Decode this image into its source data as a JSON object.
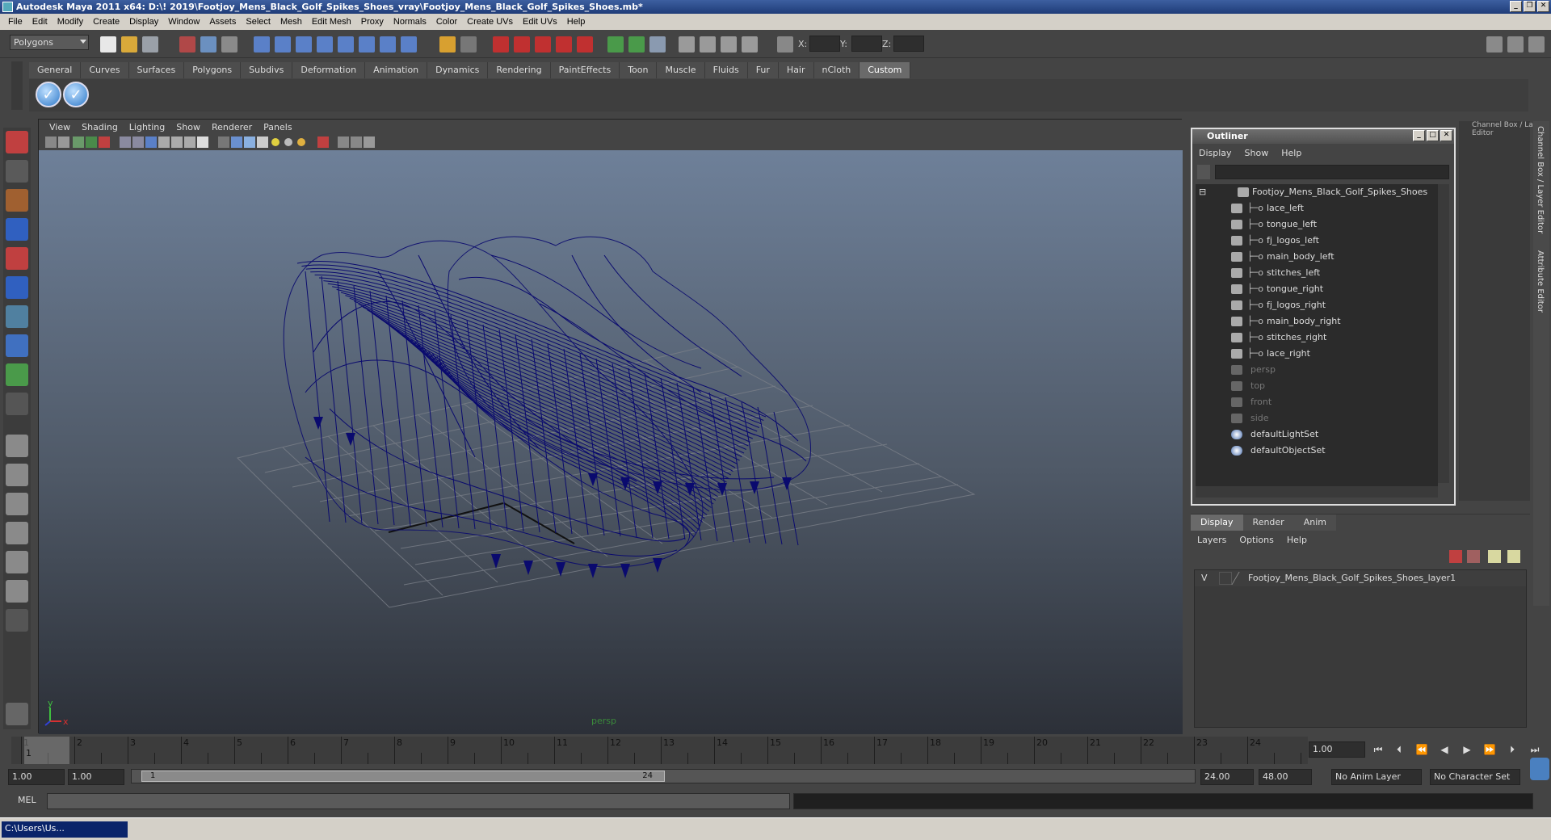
{
  "window": {
    "title": "Autodesk Maya 2011 x64: D:\\! 2019\\Footjoy_Mens_Black_Golf_Spikes_Shoes_vray\\Footjoy_Mens_Black_Golf_Spikes_Shoes.mb*"
  },
  "menubar": [
    "File",
    "Edit",
    "Modify",
    "Create",
    "Display",
    "Window",
    "Assets",
    "Select",
    "Mesh",
    "Edit Mesh",
    "Proxy",
    "Normals",
    "Color",
    "Create UVs",
    "Edit UVs",
    "Help"
  ],
  "status": {
    "menuset": "Polygons",
    "x_label": "X:",
    "y_label": "Y:",
    "z_label": "Z:"
  },
  "shelf": {
    "tabs": [
      "General",
      "Curves",
      "Surfaces",
      "Polygons",
      "Subdivs",
      "Deformation",
      "Animation",
      "Dynamics",
      "Rendering",
      "PaintEffects",
      "Toon",
      "Muscle",
      "Fluids",
      "Fur",
      "Hair",
      "nCloth",
      "Custom"
    ],
    "active_tab": "Custom"
  },
  "viewport": {
    "menu": [
      "View",
      "Shading",
      "Lighting",
      "Show",
      "Renderer",
      "Panels"
    ],
    "camera": "persp",
    "axis_y": "y",
    "axis_x": "x",
    "wire_color": "#0a0a6e"
  },
  "outliner": {
    "title": "Outliner",
    "menu": [
      "Display",
      "Show",
      "Help"
    ],
    "items": [
      {
        "label": "Footjoy_Mens_Black_Golf_Spikes_Shoes",
        "indent": 0,
        "dim": false
      },
      {
        "label": "lace_left",
        "indent": 1,
        "dim": false
      },
      {
        "label": "tongue_left",
        "indent": 1,
        "dim": false
      },
      {
        "label": "fj_logos_left",
        "indent": 1,
        "dim": false
      },
      {
        "label": "main_body_left",
        "indent": 1,
        "dim": false
      },
      {
        "label": "stitches_left",
        "indent": 1,
        "dim": false
      },
      {
        "label": "tongue_right",
        "indent": 1,
        "dim": false
      },
      {
        "label": "fj_logos_right",
        "indent": 1,
        "dim": false
      },
      {
        "label": "main_body_right",
        "indent": 1,
        "dim": false
      },
      {
        "label": "stitches_right",
        "indent": 1,
        "dim": false
      },
      {
        "label": "lace_right",
        "indent": 1,
        "dim": false
      },
      {
        "label": "persp",
        "indent": 0,
        "dim": true
      },
      {
        "label": "top",
        "indent": 0,
        "dim": true
      },
      {
        "label": "front",
        "indent": 0,
        "dim": true
      },
      {
        "label": "side",
        "indent": 0,
        "dim": true
      },
      {
        "label": "defaultLightSet",
        "indent": 0,
        "dim": false
      },
      {
        "label": "defaultObjectSet",
        "indent": 0,
        "dim": false
      }
    ]
  },
  "channelbox": {
    "label": "Channel Box / Layer Editor",
    "side_tabs": [
      "Channel Box / Layer Editor",
      "Attribute Editor"
    ]
  },
  "layers": {
    "tabs": [
      "Display",
      "Render",
      "Anim"
    ],
    "active_tab": "Display",
    "menu": [
      "Layers",
      "Options",
      "Help"
    ],
    "layer_visibility": "V",
    "layer_name": "Footjoy_Mens_Black_Golf_Spikes_Shoes_layer1"
  },
  "timeline": {
    "ticks": [
      "1",
      "2",
      "3",
      "4",
      "5",
      "6",
      "7",
      "8",
      "9",
      "10",
      "11",
      "12",
      "13",
      "14",
      "15",
      "16",
      "17",
      "18",
      "19",
      "20",
      "21",
      "22",
      "23",
      "24"
    ],
    "current_frame": "1.00",
    "current_marker": "1"
  },
  "range": {
    "start": "1.00",
    "anim_start": "1.00",
    "slider_start": "1",
    "slider_end": "24",
    "end": "24.00",
    "anim_end": "48.00",
    "anim_layer": "No Anim Layer",
    "char_set": "No Character Set"
  },
  "command": {
    "label": "MEL"
  },
  "taskbar": {
    "item": "C:\\Users\\Us..."
  }
}
